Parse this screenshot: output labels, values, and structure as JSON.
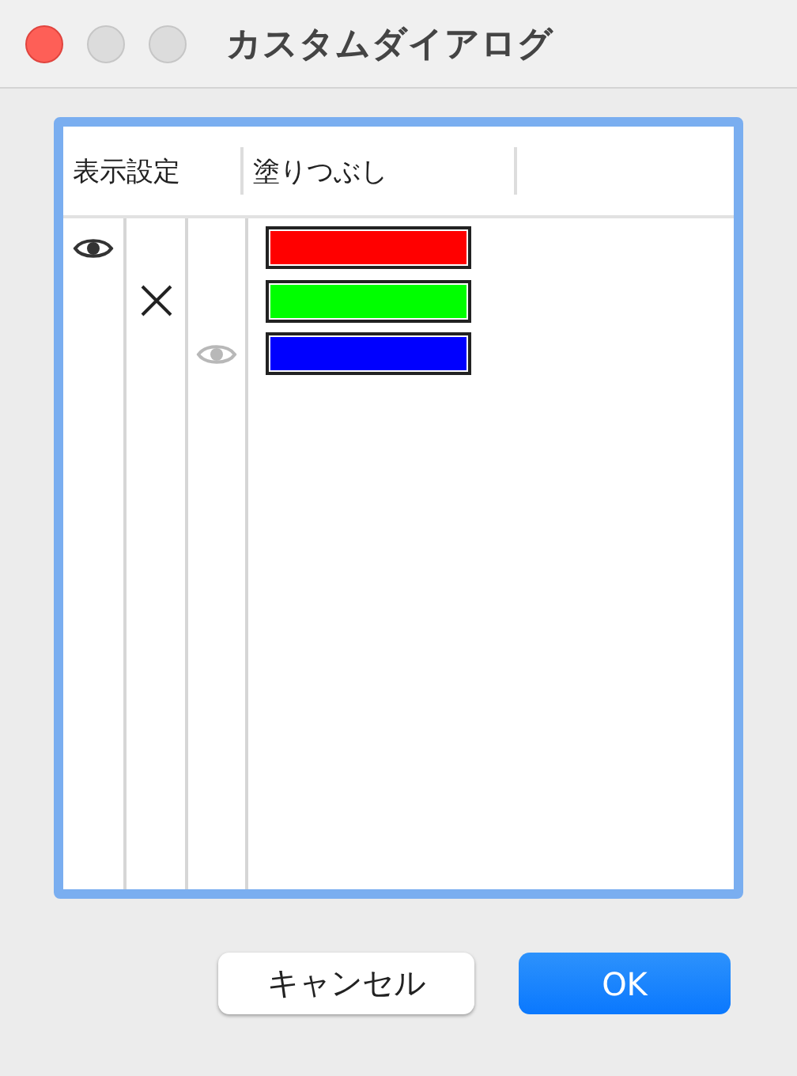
{
  "window": {
    "title": "カスタムダイアログ"
  },
  "table": {
    "columns": [
      "表示設定",
      "塗りつぶし"
    ],
    "layers": [
      {
        "visible": true,
        "dimmed": false,
        "color": "#ff0000",
        "children": [
          {
            "visible": false,
            "dimmed": false,
            "color": "#00ff00",
            "children": [
              {
                "visible": true,
                "dimmed": true,
                "color": "#0000ff"
              }
            ]
          }
        ]
      }
    ]
  },
  "buttons": [
    {
      "label": "キャンセル",
      "kind": "secondary"
    },
    {
      "label": "OK",
      "kind": "default"
    }
  ]
}
